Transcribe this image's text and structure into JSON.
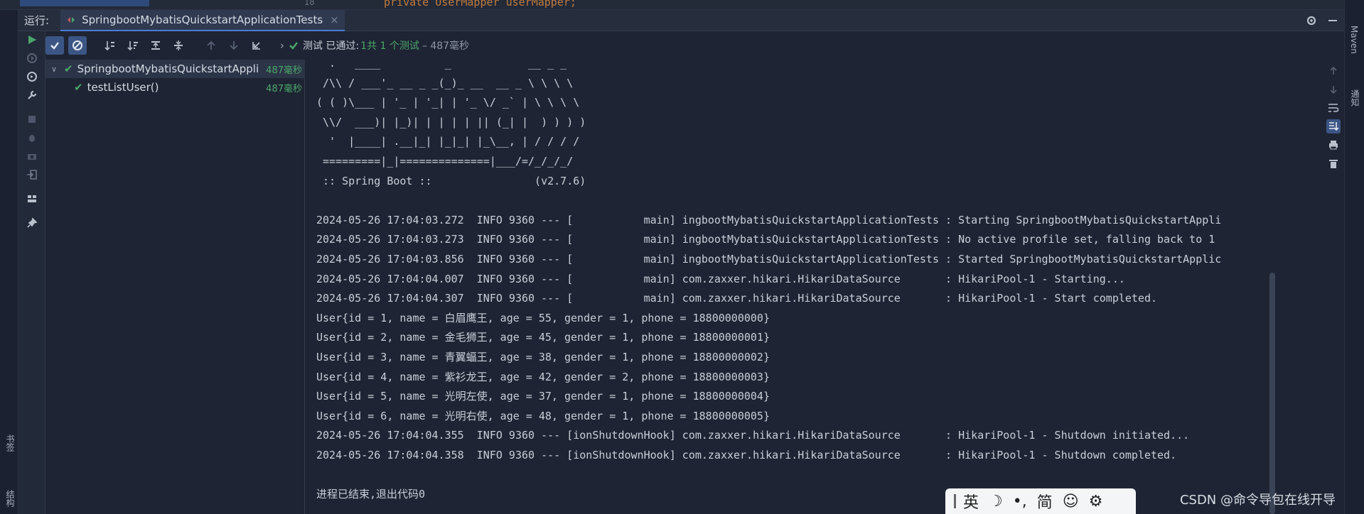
{
  "editor": {
    "line_number": "18",
    "code_fragment": "private UserMapper userMapper;"
  },
  "run_window": {
    "label": "运行:",
    "tab_title": "SpringbootMybatisQuickstartApplicationTests",
    "close_glyph": "×"
  },
  "toolbar": {
    "expand_glyph": "›",
    "status_prefix": "测试 已通过:",
    "status_count": "1共 1 个测试",
    "status_time": "– 487毫秒"
  },
  "test_tree": [
    {
      "name": "SpringbootMybatisQuickstartAppli",
      "time": "487毫秒"
    },
    {
      "name": "testListUser()",
      "time": "487毫秒"
    }
  ],
  "console_lines": [
    "  .   ____          _            __ _ _",
    " /\\\\ / ___'_ __ _ _(_)_ __  __ _ \\ \\ \\ \\",
    "( ( )\\___ | '_ | '_| | '_ \\/ _` | \\ \\ \\ \\",
    " \\\\/  ___)| |_)| | | | | || (_| |  ) ) ) )",
    "  '  |____| .__|_| |_|_| |_\\__, | / / / /",
    " =========|_|==============|___/=/_/_/_/",
    " :: Spring Boot ::                (v2.7.6)",
    "",
    "2024-05-26 17:04:03.272  INFO 9360 --- [           main] ingbootMybatisQuickstartApplicationTests : Starting SpringbootMybatisQuickstartAppli",
    "2024-05-26 17:04:03.273  INFO 9360 --- [           main] ingbootMybatisQuickstartApplicationTests : No active profile set, falling back to 1",
    "2024-05-26 17:04:03.856  INFO 9360 --- [           main] ingbootMybatisQuickstartApplicationTests : Started SpringbootMybatisQuickstartApplic",
    "2024-05-26 17:04:04.007  INFO 9360 --- [           main] com.zaxxer.hikari.HikariDataSource       : HikariPool-1 - Starting...",
    "2024-05-26 17:04:04.307  INFO 9360 --- [           main] com.zaxxer.hikari.HikariDataSource       : HikariPool-1 - Start completed.",
    "User{id = 1, name = 白眉鹰王, age = 55, gender = 1, phone = 18800000000}",
    "User{id = 2, name = 金毛狮王, age = 45, gender = 1, phone = 18800000001}",
    "User{id = 3, name = 青翼蝠王, age = 38, gender = 1, phone = 18800000002}",
    "User{id = 4, name = 紫衫龙王, age = 42, gender = 2, phone = 18800000003}",
    "User{id = 5, name = 光明左使, age = 37, gender = 1, phone = 18800000004}",
    "User{id = 6, name = 光明右使, age = 48, gender = 1, phone = 18800000005}",
    "2024-05-26 17:04:04.355  INFO 9360 --- [ionShutdownHook] com.zaxxer.hikari.HikariDataSource       : HikariPool-1 - Shutdown initiated...",
    "2024-05-26 17:04:04.358  INFO 9360 --- [ionShutdownHook] com.zaxxer.hikari.HikariDataSource       : HikariPool-1 - Shutdown completed.",
    "",
    "进程已结束,退出代码0"
  ],
  "side_labels": {
    "left_bookmarks": "书签",
    "left_structure": "结构",
    "right_maven": "Maven",
    "right_notify": "通知"
  },
  "ime": {
    "lang": "英",
    "moon": "☽",
    "punct": "•,",
    "simplified": "简",
    "emoji": "☺",
    "settings": "⚙"
  },
  "watermark": "CSDN @命令导包在线开导",
  "colors": {
    "accent": "#4b7bd8",
    "pass_green": "#4ca66a",
    "console_bg": "#1e2433"
  }
}
